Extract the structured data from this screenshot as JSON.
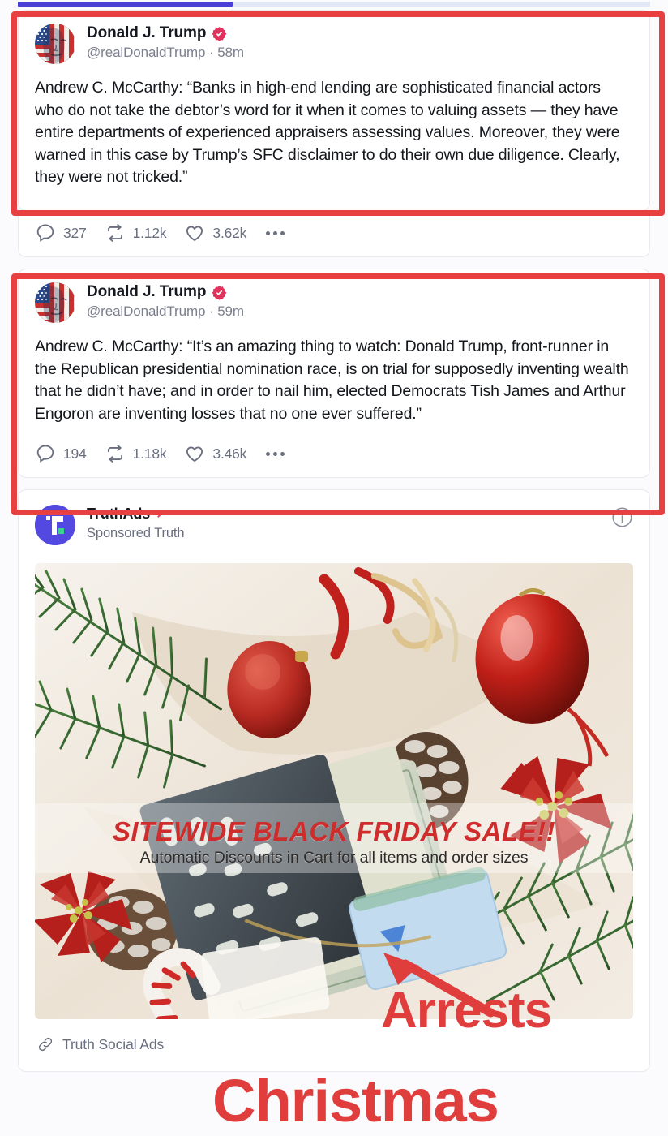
{
  "topbar": {
    "progress_percent": 34,
    "fill_color": "#4b3fd6",
    "track_color": "#e2e8f5"
  },
  "annotations": {
    "highlight_color": "#e84040",
    "marker_color": "#e03d3d",
    "labels": [
      {
        "id": "arrests",
        "text": "Arrests"
      },
      {
        "id": "christmas",
        "text": "Christmas"
      }
    ],
    "arrow": {
      "points_to": "ad-image-bottom-right",
      "color": "#e03d3d"
    },
    "boxes": [
      {
        "target": "post-1",
        "color": "#e84040"
      },
      {
        "target": "post-2",
        "color": "#e84040"
      }
    ]
  },
  "posts": [
    {
      "display_name": "Donald J. Trump",
      "verified": true,
      "verified_icon": "verified-badge-icon",
      "handle": "@realDonaldTrump",
      "separator": "·",
      "timestamp": "58m",
      "avatar_alt": "flag-face-avatar",
      "body": "Andrew C. McCarthy: “Banks in high-end lending are sophisticated financial actors who do not take the debtor’s word for it when it comes to valuing assets — they have entire departments of experienced appraisers assessing values. Moreover, they were warned in this case by Trump’s SFC disclaimer to do their own due diligence. Clearly, they were not tricked.”",
      "actions": {
        "reply_icon": "comment-icon",
        "reply_count": "327",
        "repost_icon": "retruth-icon",
        "repost_count": "1.12k",
        "like_icon": "heart-icon",
        "like_count": "3.62k",
        "more_icon": "more-horizontal-icon"
      }
    },
    {
      "display_name": "Donald J. Trump",
      "verified": true,
      "verified_icon": "verified-badge-icon",
      "handle": "@realDonaldTrump",
      "separator": "·",
      "timestamp": "59m",
      "avatar_alt": "flag-face-avatar",
      "body": "Andrew C. McCarthy: “It’s an amazing thing to watch: Donald Trump, front-runner in the Republican presidential nomination race, is on trial for supposedly inventing wealth that he didn’t have; and in order to nail him, elected Democrats Tish James and Arthur Engoron are inventing losses that no one ever suffered.”",
      "actions": {
        "reply_icon": "comment-icon",
        "reply_count": "194",
        "repost_icon": "retruth-icon",
        "repost_count": "1.18k",
        "like_icon": "heart-icon",
        "like_count": "3.46k",
        "more_icon": "more-horizontal-icon"
      }
    }
  ],
  "ad": {
    "advertiser": "TruthAds",
    "external_link_icon": "external-link-arrow-icon",
    "sponsored_label": "Sponsored Truth",
    "info_icon": "info-circle-icon",
    "logo_icon": "truthads-logo-icon",
    "logo_color": "#5348e0",
    "creative": {
      "headline": "SITEWIDE BLACK FRIDAY SALE!!",
      "subhead": "Automatic Discounts in Cart for all items and order sizes",
      "headline_color": "#cf2c2c",
      "scene": "christmas-flatlay-photo"
    },
    "footer": {
      "link_icon": "link-chain-icon",
      "link_label": "Truth Social Ads"
    }
  }
}
